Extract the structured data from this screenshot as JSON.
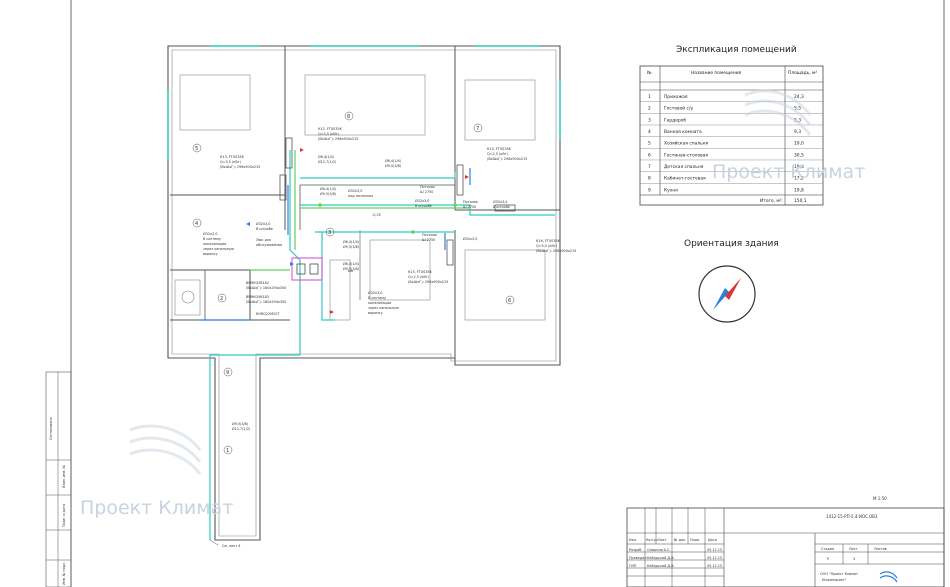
{
  "explication": {
    "title": "Экспликация помещений",
    "col_num": "№",
    "col_name": "Название помещения",
    "col_area": "Площадь, м²",
    "rows": [
      {
        "n": "1",
        "name": "Прихожая",
        "area": "24,3"
      },
      {
        "n": "2",
        "name": "Гостевой с/у",
        "area": "5,5"
      },
      {
        "n": "3",
        "name": "Гардероб",
        "area": "5,3"
      },
      {
        "n": "4",
        "name": "Ванная комната",
        "area": "9,3"
      },
      {
        "n": "5",
        "name": "Хозяйская спальня",
        "area": "19,0"
      },
      {
        "n": "6",
        "name": "Гостиная-столовая",
        "area": "30,5"
      },
      {
        "n": "7",
        "name": "Детская спальня",
        "area": "19,3"
      },
      {
        "n": "8",
        "name": "Кабинет-гостевая",
        "area": "17,2"
      },
      {
        "n": "9",
        "name": "Кухня",
        "area": "19,8"
      }
    ],
    "total_label": "Итого, м²:",
    "total_value": "150,1"
  },
  "orientation": {
    "title": "Ориентация здания"
  },
  "watermark": "Проект Климат",
  "plan": {
    "rooms": [
      "1",
      "2",
      "3",
      "4",
      "5",
      "6",
      "7",
      "8",
      "9"
    ],
    "labels": {
      "k12": "К12, FTXS35K",
      "k13": "К13, FTXS35K",
      "k15": "К15, FTXS35K",
      "k16": "К16, FTXS35K",
      "k17": "К17, FTXS35K",
      "spec1": "Q=3,5 (кВт)",
      "spec2": "(ВхШхГ): 298х900х215",
      "spec3": "Q=2,5 (кВт)",
      "spec4": "Q=5,0 (кВт)",
      "pipe1": "Ø6,4(1/4)",
      "pipe2": "Ø9,5(3/8)",
      "pipe3": "Ø12,7(1/2)",
      "drain": "Ø32х3,0",
      "drain_note1": "В систему",
      "drain_note2": "канализации",
      "drain_note3": "через канальную",
      "drain_note4": "воронку",
      "shtroba": "В штробе",
      "luk": "Люк для",
      "luk2": "обслуживания",
      "bpm1": "BPMKQ98182",
      "bpm2": "BPMKQ98183",
      "bpm_dim": "(ВхШхГ): 180х294х350",
      "kh": "KHRQ22M20T",
      "pod_pot": "под потолком",
      "mark_mm": "мм",
      "potolok": "Потолок",
      "level": "Ш 2750",
      "val_minus": "-0,25",
      "cm_list": "См. лист 4"
    }
  },
  "titleblock": {
    "scale": "М 1:50",
    "code": "1412-15-РП-5.4-ИОС.ОВ3",
    "stage_h": "Стадия",
    "sheet_h": "Лист",
    "sheets_h": "Листов",
    "stage": "Р",
    "sheet": "3",
    "company1": "ООО \"Проект Климат",
    "company2": "Инжиниринг\"",
    "head": [
      "Изм.",
      "Кол.уч",
      "Лист",
      "№ док.",
      "Подп.",
      "Дата"
    ],
    "roles": [
      {
        "role": "Разраб.",
        "name": "Смирнов А.С.",
        "date": "05.12.15"
      },
      {
        "role": "Проверил",
        "name": "Кабадский Д.В.",
        "date": "05.12.15"
      },
      {
        "role": "ГИП",
        "name": "Кабадский Д.В.",
        "date": "05.12.15"
      }
    ]
  },
  "side_stamp": {
    "agreed": "Согласовано",
    "inv_orig": "Инв. № подл.",
    "sign_date": "Подп. и дата",
    "inv_dup": "Взам. инв. №"
  }
}
